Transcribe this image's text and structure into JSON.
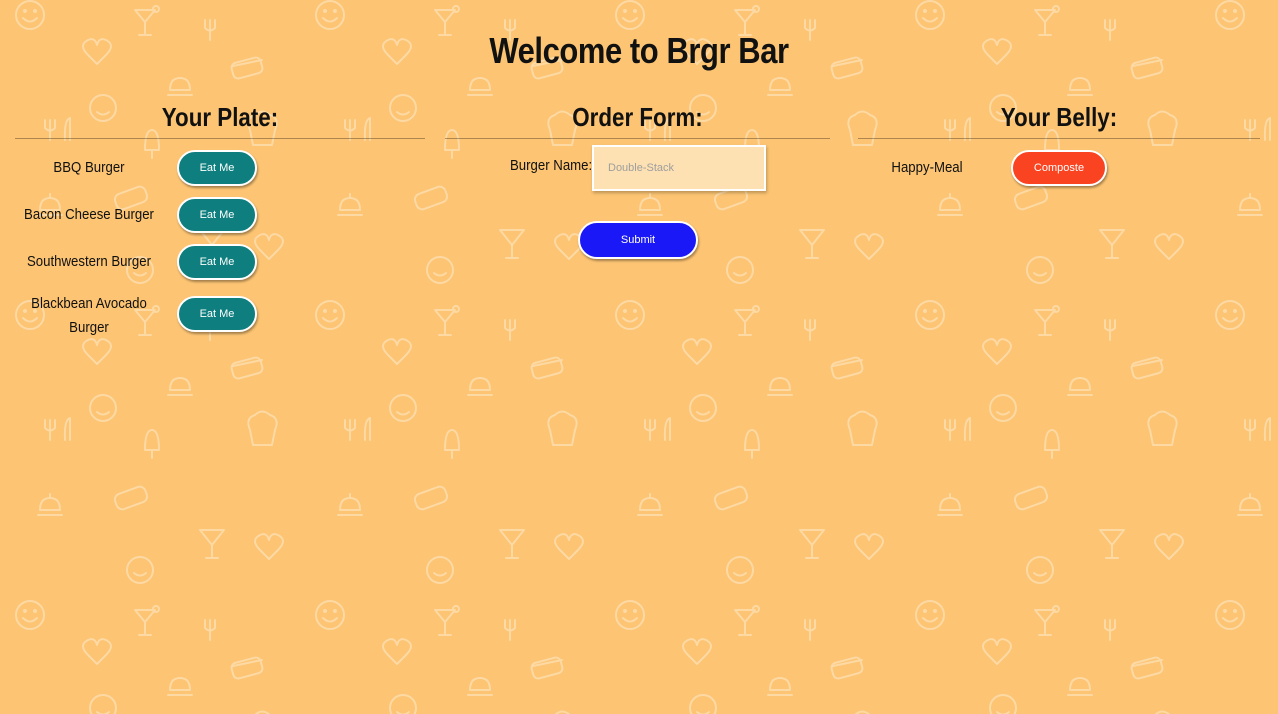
{
  "page": {
    "title": "Welcome to Brgr Bar"
  },
  "plate": {
    "heading": "Your Plate:",
    "button_label": "Eat Me",
    "items": [
      {
        "name": "BBQ Burger"
      },
      {
        "name": "Bacon Cheese Burger"
      },
      {
        "name": "Southwestern Burger"
      },
      {
        "name": "Blackbean Avocado Burger"
      }
    ]
  },
  "order_form": {
    "heading": "Order Form:",
    "label": "Burger Name:",
    "placeholder": "Double-Stack",
    "value": "",
    "submit_label": "Submit"
  },
  "belly": {
    "heading": "Your Belly:",
    "button_label": "Composte",
    "items": [
      {
        "name": "Happy-Meal"
      }
    ]
  },
  "colors": {
    "background": "#fcc473",
    "eat_button": "#0e7e7e",
    "compost_button": "#fa4320",
    "submit_button": "#1a18f6"
  }
}
